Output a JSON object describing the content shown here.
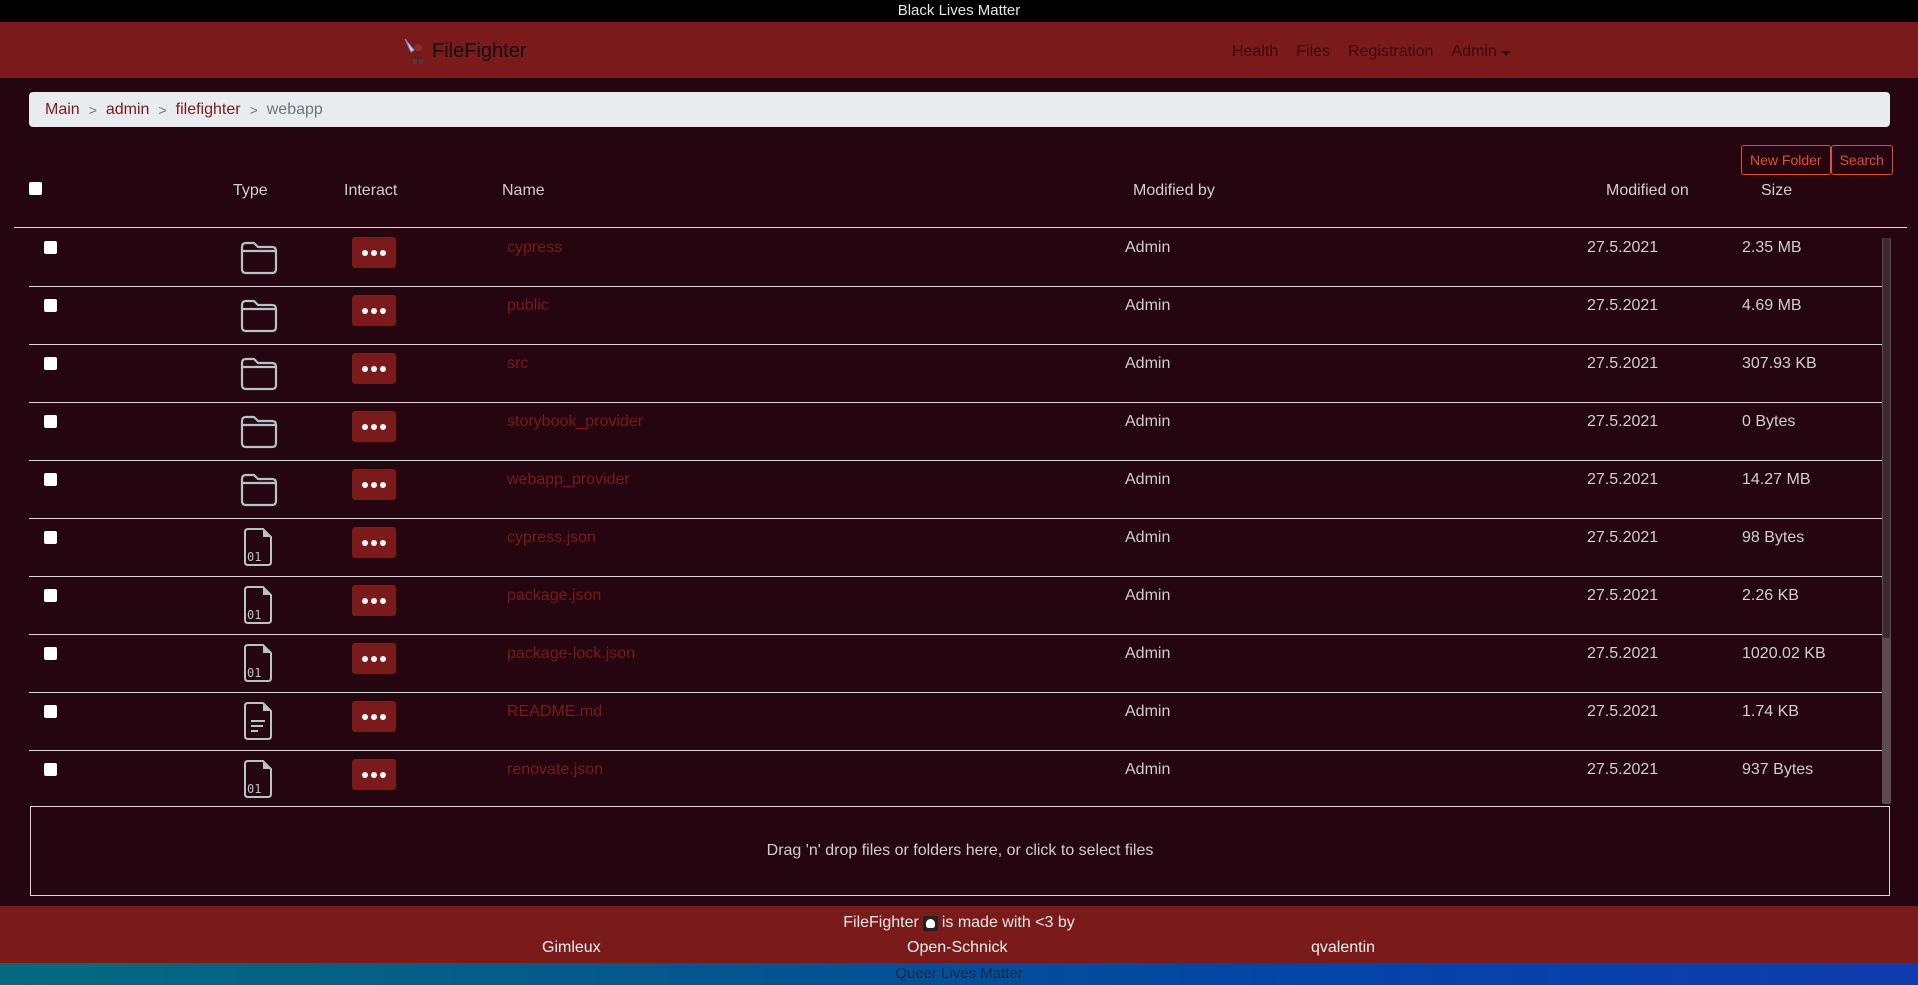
{
  "banner_top": "Black Lives Matter",
  "navbar": {
    "brand": "FileFighter",
    "links": [
      "Health",
      "Files",
      "Registration"
    ],
    "dropdown_label": "Admin"
  },
  "breadcrumb": {
    "links": [
      "Main",
      "admin",
      "filefighter"
    ],
    "separator": ">",
    "current": "webapp"
  },
  "toolbar": {
    "new_folder_label": "New Folder",
    "search_label": "Search"
  },
  "table": {
    "columns": {
      "type": "Type",
      "interact": "Interact",
      "name": "Name",
      "modified_by": "Modified by",
      "modified_on": "Modified on",
      "size": "Size"
    },
    "rows": [
      {
        "type": "folder",
        "name": "cypress",
        "modified_by": "Admin",
        "modified_on": "27.5.2021",
        "size": "2.35 MB"
      },
      {
        "type": "folder",
        "name": "public",
        "modified_by": "Admin",
        "modified_on": "27.5.2021",
        "size": "4.69 MB"
      },
      {
        "type": "folder",
        "name": "src",
        "modified_by": "Admin",
        "modified_on": "27.5.2021",
        "size": "307.93 KB"
      },
      {
        "type": "folder",
        "name": "storybook_provider",
        "modified_by": "Admin",
        "modified_on": "27.5.2021",
        "size": "0 Bytes"
      },
      {
        "type": "folder",
        "name": "webapp_provider",
        "modified_by": "Admin",
        "modified_on": "27.5.2021",
        "size": "14.27 MB"
      },
      {
        "type": "binary-file",
        "name": "cypress.json",
        "modified_by": "Admin",
        "modified_on": "27.5.2021",
        "size": "98 Bytes"
      },
      {
        "type": "binary-file",
        "name": "package.json",
        "modified_by": "Admin",
        "modified_on": "27.5.2021",
        "size": "2.26 KB"
      },
      {
        "type": "binary-file",
        "name": "package-lock.json",
        "modified_by": "Admin",
        "modified_on": "27.5.2021",
        "size": "1020.02 KB"
      },
      {
        "type": "text-file",
        "name": "README.md",
        "modified_by": "Admin",
        "modified_on": "27.5.2021",
        "size": "1.74 KB"
      },
      {
        "type": "binary-file",
        "name": "renovate.json",
        "modified_by": "Admin",
        "modified_on": "27.5.2021",
        "size": "937 Bytes"
      }
    ]
  },
  "dropzone": {
    "text": "Drag 'n' drop files or folders here, or click to select files"
  },
  "footer": {
    "project": "FileFighter",
    "tagline": "is made with <3 by",
    "authors": [
      "Gimleux",
      "Open-Schnick",
      "qvalentin"
    ]
  },
  "banner_bottom": "Queer Lives Matter",
  "colors": {
    "brand": "#7b1a1b",
    "background": "#240510",
    "accent_outline": "#e24f34"
  }
}
